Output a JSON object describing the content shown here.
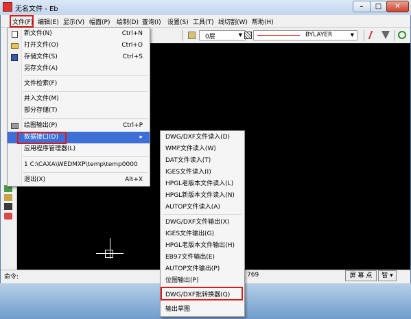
{
  "window": {
    "title": "无名文件 - Eb",
    "min_glyph": "–",
    "max_glyph": "□",
    "close_glyph": "✕"
  },
  "menubar": {
    "items": [
      "文件(F)",
      "编辑(E)",
      "显示(V)",
      "幅面(P)",
      "绘制(D)",
      "查询(I)",
      "设置(S)",
      "工具(T)",
      "线切割(W)",
      "帮助(H)"
    ]
  },
  "toolbar": {
    "layer_value": "0层",
    "linetype_value": "BYLAYER",
    "combo_arrow": "▼"
  },
  "file_menu": {
    "items": [
      {
        "label": "新文件(N)",
        "shortcut": "Ctrl+N"
      },
      {
        "label": "打开文件(O)",
        "shortcut": "Ctrl+O"
      },
      {
        "label": "存储文件(S)",
        "shortcut": "Ctrl+S"
      },
      {
        "label": "另存文件(A)",
        "shortcut": ""
      },
      {
        "label": "文件检索(F)",
        "shortcut": ""
      },
      {
        "label": "并入文件(M)",
        "shortcut": ""
      },
      {
        "label": "部分存储(T)",
        "shortcut": ""
      },
      {
        "label": "绘图输出(P)",
        "shortcut": "Ctrl+P"
      },
      {
        "label": "数据接口(D)",
        "shortcut": "▸"
      },
      {
        "label": "应用程序管理器(L)",
        "shortcut": ""
      },
      {
        "label": "1 C:\\CAXA\\WEDMXP\\temp\\temp0000",
        "shortcut": ""
      },
      {
        "label": "退出(X)",
        "shortcut": "Alt+X"
      }
    ]
  },
  "submenu": {
    "items": [
      "DWG/DXF文件读入(D)",
      "WMF文件读入(W)",
      "DAT文件读入(T)",
      "IGES文件读入(I)",
      "HPGL老版本文件读入(L)",
      "HPGL新版本文件读入(N)",
      "AUTOP文件读入(A)",
      "DWG/DXF文件输出(X)",
      "IGES文件输出(G)",
      "HPGL老版本文件输出(H)",
      "EB97文件输出(E)",
      "AUTOP文件输出(P)",
      "位图输出(P)",
      "DWG/DXF批转换器(Q)",
      "输出草图"
    ]
  },
  "status": {
    "command_label": "命令:",
    "coord_fragment": "769",
    "snap_mode": "屏 幕 点",
    "smart_mode": "智 ▾"
  },
  "colors": {
    "highlight": "#3d6fd6",
    "annotation_red": "#e01818",
    "canvas": "#000000"
  }
}
